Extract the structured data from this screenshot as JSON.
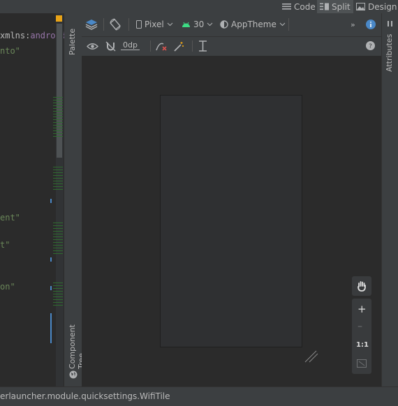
{
  "modes": {
    "code": "Code",
    "split": "Split",
    "design": "Design"
  },
  "code_lines": [
    {
      "prefix": "xmlns:",
      "prefix_class": "t",
      "rest": "android=",
      "rest_class": "p"
    },
    {
      "prefix": "nto\"",
      "prefix_class": "g",
      "rest": "",
      "rest_class": "g"
    },
    {
      "prefix": "ent\"",
      "prefix_class": "g",
      "rest": "",
      "rest_class": "g"
    },
    {
      "prefix": "t\"",
      "prefix_class": "g",
      "rest": "",
      "rest_class": "g"
    },
    {
      "prefix": "on\"",
      "prefix_class": "g",
      "rest": "",
      "rest_class": "g"
    }
  ],
  "side_tabs": {
    "palette": "Palette",
    "component_tree": "Component Tree",
    "attributes": "Attributes"
  },
  "toolbar": {
    "device": "Pixel",
    "api": "30",
    "theme": "AppTheme",
    "margin": "0dp"
  },
  "zoom": {
    "one_to_one": "1:1"
  },
  "status": {
    "text": "erlauncher.module.quicksettings.WifiTile"
  },
  "colors": {
    "accent": "#4a88c7",
    "android_green": "#3ddc84",
    "warning": "#e8a317"
  }
}
